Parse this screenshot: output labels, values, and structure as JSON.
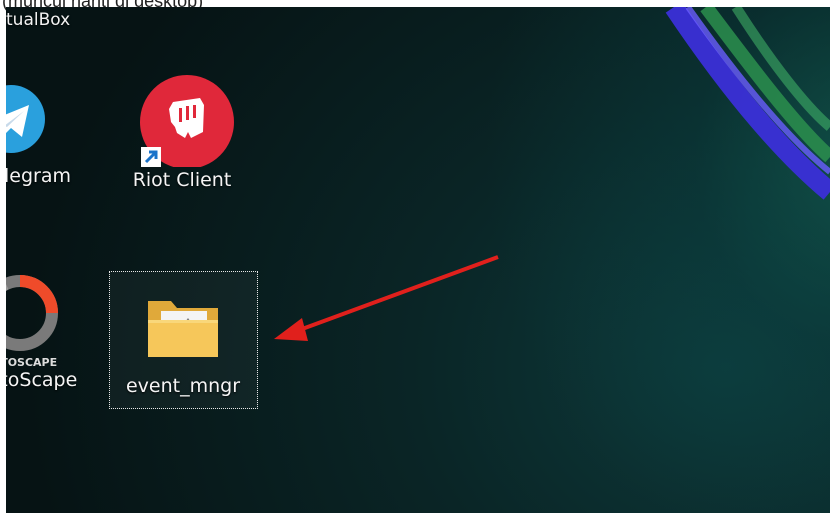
{
  "top_caption": "(muncul nanti di desktop)",
  "desktop": {
    "virtualbox_label": "tualBox",
    "icons": [
      {
        "name": "telegram",
        "label": "legram",
        "icon": "telegram-icon"
      },
      {
        "name": "riot-client",
        "label": "Riot Client",
        "icon": "riot-client-icon"
      },
      {
        "name": "photoscape",
        "label": "otoScape",
        "icon": "photoscape-icon",
        "logo_text": "OTOSCAPE"
      },
      {
        "name": "event-mngr",
        "label": "event_mngr",
        "icon": "folder-icon",
        "selected": true
      }
    ]
  },
  "annotation": {
    "type": "arrow",
    "color": "#e0201c"
  },
  "colors": {
    "telegram": "#2aa0dd",
    "riot": "#e0283a",
    "folder": "#f6c75a",
    "arrow": "#e0201c"
  }
}
